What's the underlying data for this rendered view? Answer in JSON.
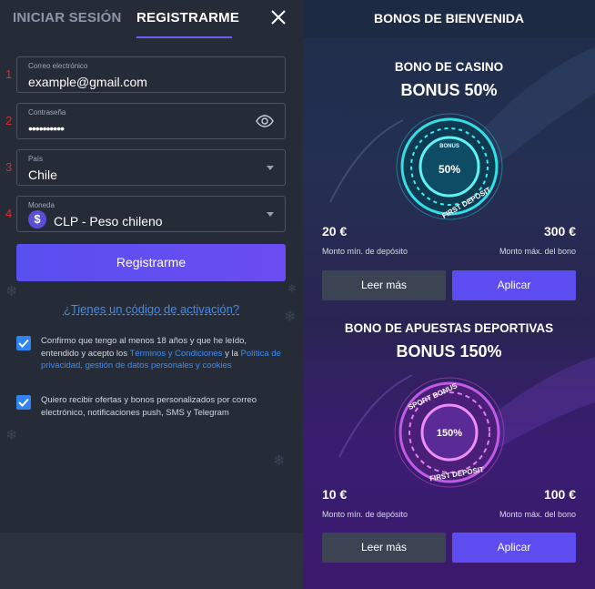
{
  "tabs": {
    "login": "INICIAR SESIÓN",
    "register": "REGISTRARME"
  },
  "form": {
    "fields": [
      {
        "num": "1",
        "label": "Correo electrónico",
        "value": "example@gmail.com"
      },
      {
        "num": "2",
        "label": "Contraseña",
        "value": "••••••••••"
      },
      {
        "num": "3",
        "label": "País",
        "value": "Chile"
      },
      {
        "num": "4",
        "label": "Moneda",
        "value": "CLP - Peso chileno",
        "currency_symbol": "$"
      }
    ],
    "submit_label": "Registrarme",
    "activation_link": "¿Tienes un código de activación?",
    "consent_1": {
      "text_a": "Confirmo que tengo al menos 18 años y que he leído, entendido y acepto los ",
      "link_terms": "Términos y Condiciones",
      "text_b": " y la ",
      "link_privacy": "Política de privacidad, gestión de datos personales y cookies"
    },
    "consent_2": "Quiero recibir ofertas y bonos personalizados por correo electrónico, notificaciones push, SMS y Telegram"
  },
  "bonuses": {
    "header": "BONOS DE BIENVENIDA",
    "items": [
      {
        "title": "BONO DE CASINO",
        "percent": "BONUS 50%",
        "badge_top": "BONUS",
        "badge_center": "50%",
        "badge_bottom": "FIRST DEPOSIT",
        "min_amount": "20 €",
        "min_label": "Monto mín. de depósito",
        "max_amount": "300 €",
        "max_label": "Monto máx. del bono",
        "read_more": "Leer más",
        "apply": "Aplicar"
      },
      {
        "title": "BONO DE APUESTAS DEPORTIVAS",
        "percent": "BONUS 150%",
        "badge_top": "SPORT BONUS",
        "badge_center": "150%",
        "badge_bottom": "FIRST DEPOSIT",
        "min_amount": "10 €",
        "min_label": "Monto mín. de depósito",
        "max_amount": "100 €",
        "max_label": "Monto máx. del bono",
        "read_more": "Leer más",
        "apply": "Aplicar"
      }
    ]
  },
  "colors": {
    "accent": "#5d4cf0",
    "link": "#3e8df4",
    "field_number": "#e32a2a",
    "checkbox": "#2f84f0"
  }
}
